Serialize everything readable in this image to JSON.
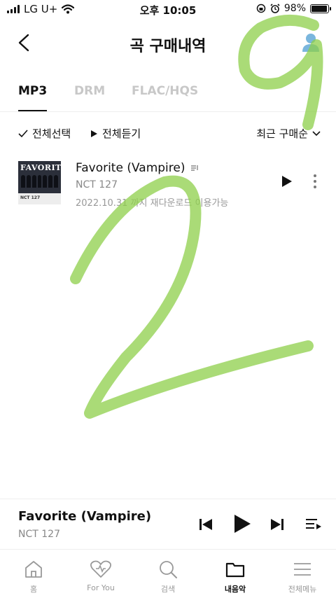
{
  "status_bar": {
    "carrier": "LG U+",
    "time": "오후 10:05",
    "battery": "98%",
    "battery_level": 0.98
  },
  "header": {
    "title": "곡 구매내역"
  },
  "tabs": [
    {
      "label": "MP3",
      "active": true
    },
    {
      "label": "DRM",
      "active": false
    },
    {
      "label": "FLAC/HQS",
      "active": false
    }
  ],
  "actions": {
    "select_all": "전체선택",
    "play_all": "전체듣기",
    "sort": "최근 구매순"
  },
  "tracks": [
    {
      "title": "Favorite (Vampire)",
      "artist": "NCT 127",
      "expiry": "2022.10.31 까지 재다운로드 이용가능",
      "cover_text": "FAVORITE",
      "cover_caption": "NCT 127"
    }
  ],
  "player": {
    "title": "Favorite (Vampire)",
    "artist": "NCT 127"
  },
  "tabbar": [
    {
      "label": "홈",
      "icon": "home-icon",
      "active": false
    },
    {
      "label": "For You",
      "icon": "heart-icon",
      "active": false
    },
    {
      "label": "검색",
      "icon": "search-icon",
      "active": false
    },
    {
      "label": "내음악",
      "icon": "folder-icon",
      "active": true
    },
    {
      "label": "전체메뉴",
      "icon": "menu-icon",
      "active": false
    }
  ],
  "colors": {
    "brush": "#8dcf4a",
    "text": "#111111",
    "muted": "#888888",
    "inactive": "#c8c8c8",
    "avatar": "#7ab6dd"
  }
}
